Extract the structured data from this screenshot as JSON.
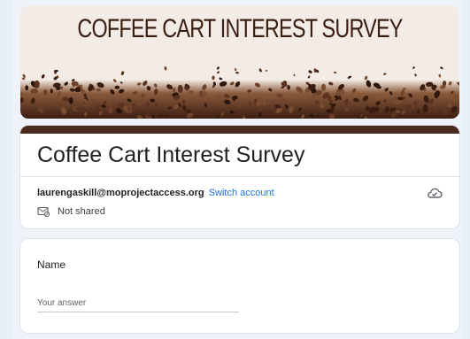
{
  "banner": {
    "title": "COFFEE CART INTEREST SURVEY"
  },
  "form": {
    "title": "Coffee Cart Interest Survey",
    "account_email": "laurengaskill@moprojectaccess.org",
    "switch_account_label": "Switch account",
    "not_shared_label": "Not shared"
  },
  "questions": [
    {
      "label": "Name",
      "placeholder": "Your answer"
    }
  ],
  "icons": {
    "cloud": "cloud-save-icon",
    "not_shared": "not-shared-icon"
  },
  "colors": {
    "accent": "#4a2a1f",
    "link": "#1a73e8",
    "background": "#e8eff8"
  }
}
